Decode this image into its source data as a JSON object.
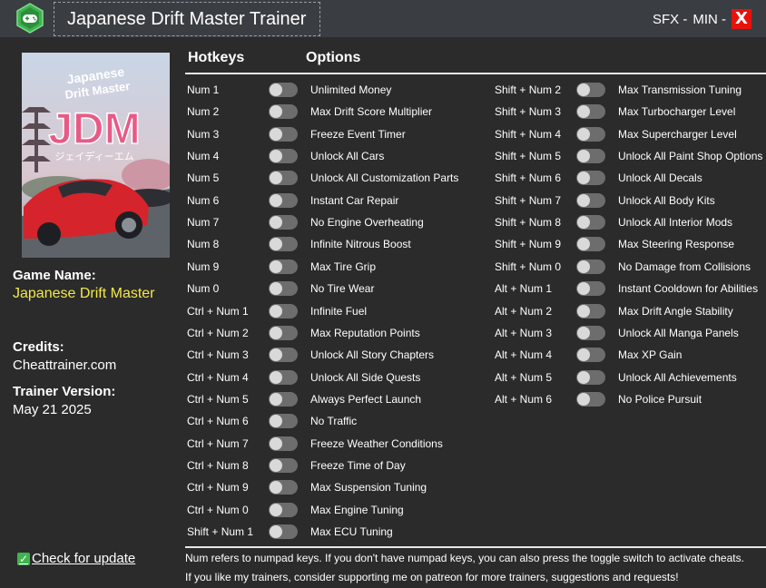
{
  "window": {
    "title": "Japanese Drift Master Trainer",
    "sfx_label": "SFX -",
    "min_label": "MIN -",
    "close_label": "X"
  },
  "sidebar": {
    "cover": {
      "line1": "Japanese",
      "line2": "Drift Master",
      "logo": "JDM",
      "kana": "ジェイディーエム"
    },
    "game_name_label": "Game Name:",
    "game_name": "Japanese Drift Master",
    "credits_label": "Credits:",
    "credits": "Cheattrainer.com",
    "version_label": "Trainer Version:",
    "version": "May 21 2025",
    "update_label": "Check for update"
  },
  "headers": {
    "hotkeys": "Hotkeys",
    "options": "Options"
  },
  "cheats_left": [
    {
      "key": "Num 1",
      "option": "Unlimited Money"
    },
    {
      "key": "Num 2",
      "option": "Max Drift Score Multiplier"
    },
    {
      "key": "Num 3",
      "option": "Freeze Event Timer"
    },
    {
      "key": "Num 4",
      "option": "Unlock All Cars"
    },
    {
      "key": "Num 5",
      "option": "Unlock All Customization Parts"
    },
    {
      "key": "Num 6",
      "option": "Instant Car Repair"
    },
    {
      "key": "Num 7",
      "option": "No Engine Overheating"
    },
    {
      "key": "Num 8",
      "option": "Infinite Nitrous Boost"
    },
    {
      "key": "Num 9",
      "option": "Max Tire Grip"
    },
    {
      "key": "Num 0",
      "option": "No Tire Wear"
    },
    {
      "key": "Ctrl + Num 1",
      "option": "Infinite Fuel"
    },
    {
      "key": "Ctrl + Num 2",
      "option": "Max Reputation Points"
    },
    {
      "key": "Ctrl + Num 3",
      "option": "Unlock All Story Chapters"
    },
    {
      "key": "Ctrl + Num 4",
      "option": "Unlock All Side Quests"
    },
    {
      "key": "Ctrl + Num 5",
      "option": "Always Perfect Launch"
    },
    {
      "key": "Ctrl + Num 6",
      "option": "No Traffic"
    },
    {
      "key": "Ctrl + Num 7",
      "option": "Freeze Weather Conditions"
    },
    {
      "key": "Ctrl + Num 8",
      "option": "Freeze Time of Day"
    },
    {
      "key": "Ctrl + Num 9",
      "option": "Max Suspension Tuning"
    },
    {
      "key": "Ctrl + Num 0",
      "option": "Max Engine Tuning"
    },
    {
      "key": "Shift + Num 1",
      "option": "Max ECU Tuning"
    }
  ],
  "cheats_right": [
    {
      "key": "Shift + Num 2",
      "option": "Max Transmission Tuning"
    },
    {
      "key": "Shift + Num 3",
      "option": "Max Turbocharger Level"
    },
    {
      "key": "Shift + Num 4",
      "option": "Max Supercharger Level"
    },
    {
      "key": "Shift + Num 5",
      "option": "Unlock All Paint Shop Options"
    },
    {
      "key": "Shift + Num 6",
      "option": "Unlock All Decals"
    },
    {
      "key": "Shift + Num 7",
      "option": "Unlock All Body Kits"
    },
    {
      "key": "Shift + Num 8",
      "option": "Unlock All Interior Mods"
    },
    {
      "key": "Shift + Num 9",
      "option": "Max Steering Response"
    },
    {
      "key": "Shift + Num 0",
      "option": "No Damage from Collisions"
    },
    {
      "key": "Alt + Num 1",
      "option": "Instant Cooldown for Abilities"
    },
    {
      "key": "Alt + Num 2",
      "option": "Max Drift Angle Stability"
    },
    {
      "key": "Alt + Num 3",
      "option": "Unlock All Manga Panels"
    },
    {
      "key": "Alt + Num 4",
      "option": "Max XP Gain"
    },
    {
      "key": "Alt + Num 5",
      "option": "Unlock All Achievements"
    },
    {
      "key": "Alt + Num 6",
      "option": "No Police Pursuit"
    }
  ],
  "footer": {
    "line1": "Num refers to numpad keys. If you don't have numpad keys, you can also press the toggle switch to activate cheats.",
    "line2": "If you like my trainers, consider supporting me on patreon for more trainers, suggestions and requests!"
  },
  "colors": {
    "background": "#2b2b2b",
    "titlebar": "#3a3d42",
    "accent_yellow": "#f4e84a",
    "close_red": "#e8120c",
    "toggle_off": "#6d6d6d",
    "icon_green": "#3fb34f"
  },
  "icons": {
    "app": "gamepad-icon",
    "update": "check-mark-icon"
  }
}
